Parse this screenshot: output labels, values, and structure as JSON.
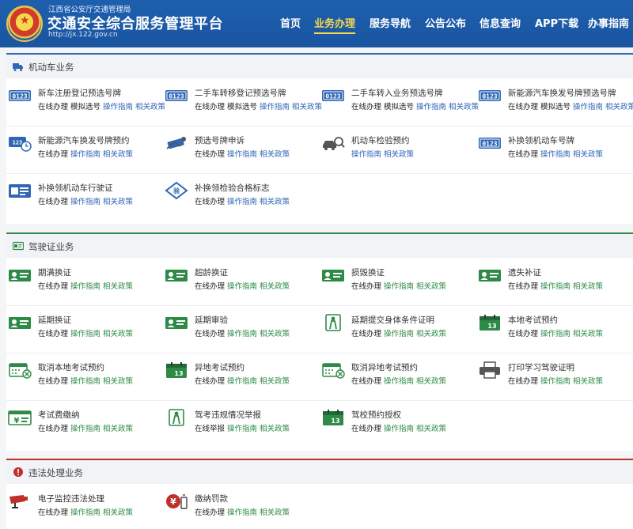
{
  "header": {
    "sub_title": "江西省公安厅交通管理局",
    "title": "交通安全综合服务管理平台",
    "url": "http://jx.122.gov.cn",
    "nav": [
      "首页",
      "业务办理",
      "服务导航",
      "公告公布",
      "信息查询",
      "APP下载",
      "办事指南"
    ],
    "active_nav": "业务办理"
  },
  "colors": {
    "header_blue": "#1a55a0",
    "active_yellow": "#f5d84d",
    "motor_accent": "#2f66b5",
    "license_accent": "#2e8a47",
    "violation_accent": "#c0302a"
  },
  "sections": [
    {
      "title": "机动车业务",
      "icon": "truck-icon",
      "items": [
        {
          "name": "新车注册登记预选号牌",
          "icon": "plate-number-icon",
          "links": [
            "在线办理",
            "模拟选号",
            "操作指南",
            "相关政策"
          ]
        },
        {
          "name": "二手车转移登记预选号牌",
          "icon": "plate-number-icon",
          "links": [
            "在线办理",
            "模拟选号",
            "操作指南",
            "相关政策"
          ]
        },
        {
          "name": "二手车转入业务预选号牌",
          "icon": "plate-number-icon",
          "links": [
            "在线办理",
            "模拟选号",
            "操作指南",
            "相关政策"
          ]
        },
        {
          "name": "新能源汽车换发号牌预选号牌",
          "icon": "plate-number-icon",
          "links": [
            "在线办理",
            "模拟选号",
            "操作指南",
            "相关政策"
          ]
        },
        {
          "name": "新能源汽车换发号牌预约",
          "icon": "plate-clock-icon",
          "links": [
            "在线办理",
            "操作指南",
            "相关政策"
          ]
        },
        {
          "name": "预选号牌申诉",
          "icon": "appeal-icon",
          "links": [
            "在线办理",
            "操作指南",
            "相关政策"
          ]
        },
        {
          "name": "机动车检验预约",
          "icon": "car-inspect-icon",
          "links": [
            "操作指南",
            "相关政策"
          ]
        },
        {
          "name": "补换领机动车号牌",
          "icon": "plate-number-icon",
          "links": [
            "在线办理",
            "操作指南",
            "相关政策"
          ]
        },
        {
          "name": "补换领机动车行驶证",
          "icon": "license-card-icon",
          "links": [
            "在线办理",
            "操作指南",
            "相关政策"
          ]
        },
        {
          "name": "补换领检验合格标志",
          "icon": "diamond-badge-icon",
          "links": [
            "在线办理",
            "操作指南",
            "相关政策"
          ]
        }
      ]
    },
    {
      "title": "驾驶证业务",
      "icon": "id-card-icon",
      "items": [
        {
          "name": "期满换证",
          "icon": "id-card-icon",
          "links": [
            "在线办理",
            "操作指南",
            "相关政策"
          ]
        },
        {
          "name": "超龄换证",
          "icon": "id-card-icon",
          "links": [
            "在线办理",
            "操作指南",
            "相关政策"
          ]
        },
        {
          "name": "损毁换证",
          "icon": "id-card-icon",
          "links": [
            "在线办理",
            "操作指南",
            "相关政策"
          ]
        },
        {
          "name": "遗失补证",
          "icon": "id-card-icon",
          "links": [
            "在线办理",
            "操作指南",
            "相关政策"
          ]
        },
        {
          "name": "延期换证",
          "icon": "id-card-icon",
          "links": [
            "在线办理",
            "操作指南",
            "相关政策"
          ]
        },
        {
          "name": "延期审验",
          "icon": "id-card-icon",
          "links": [
            "在线办理",
            "操作指南",
            "相关政策"
          ]
        },
        {
          "name": "延期提交身体条件证明",
          "icon": "person-icon",
          "links": [
            "在线办理",
            "操作指南",
            "相关政策"
          ]
        },
        {
          "name": "本地考试预约",
          "icon": "calendar-icon",
          "links": [
            "在线办理",
            "操作指南",
            "相关政策"
          ]
        },
        {
          "name": "取消本地考试预约",
          "icon": "calendar-cancel-icon",
          "links": [
            "在线办理",
            "操作指南",
            "相关政策"
          ]
        },
        {
          "name": "异地考试预约",
          "icon": "calendar-icon",
          "links": [
            "在线办理",
            "操作指南",
            "相关政策"
          ]
        },
        {
          "name": "取消异地考试预约",
          "icon": "calendar-cancel-icon",
          "links": [
            "在线办理",
            "操作指南",
            "相关政策"
          ]
        },
        {
          "name": "打印学习驾驶证明",
          "icon": "printer-icon",
          "links": [
            "在线办理",
            "操作指南",
            "相关政策"
          ]
        },
        {
          "name": "考试费缴纳",
          "icon": "payment-icon",
          "links": [
            "在线办理",
            "操作指南",
            "相关政策"
          ]
        },
        {
          "name": "驾考违规情况举报",
          "icon": "person-icon",
          "links": [
            "在线举报",
            "操作指南",
            "相关政策"
          ]
        },
        {
          "name": "驾校预约授权",
          "icon": "calendar-icon",
          "links": [
            "在线办理",
            "操作指南",
            "相关政策"
          ]
        }
      ]
    },
    {
      "title": "违法处理业务",
      "icon": "alert-icon",
      "items": [
        {
          "name": "电子监控违法处理",
          "icon": "camera-icon",
          "links": [
            "在线办理",
            "操作指南",
            "相关政策"
          ]
        },
        {
          "name": "缴纳罚款",
          "icon": "yuan-fine-icon",
          "links": [
            "在线办理",
            "操作指南",
            "相关政策"
          ]
        }
      ]
    }
  ]
}
